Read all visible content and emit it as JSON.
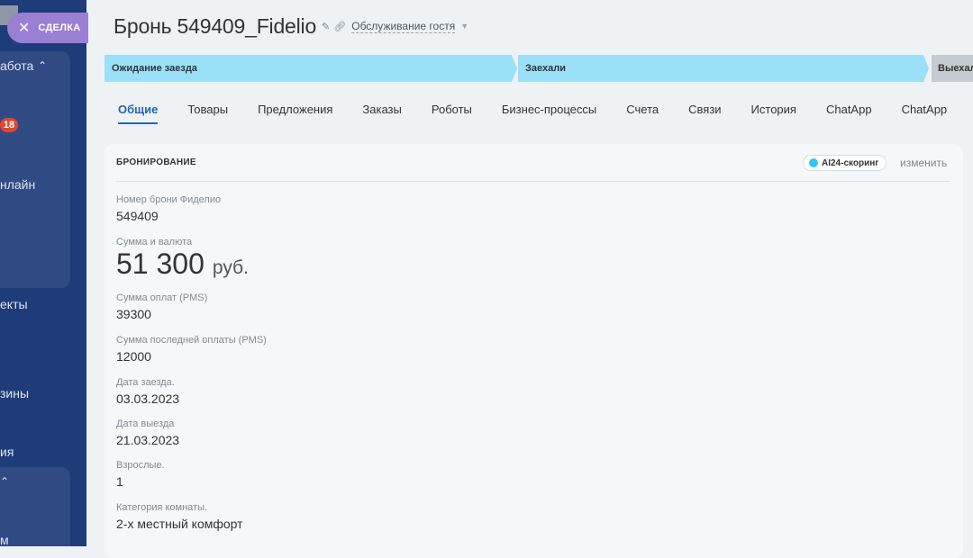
{
  "sidebar": {
    "close_label": "СДЕЛКА",
    "items": [
      {
        "label": "абота"
      },
      {
        "label": "нлайн"
      },
      {
        "label": "екты"
      },
      {
        "label": "зины"
      },
      {
        "label": "ия"
      },
      {
        "label": "м"
      }
    ],
    "badge_count": "18"
  },
  "header": {
    "title": "Бронь 549409_Fidelio",
    "category": "Обслуживание гостя"
  },
  "stages": [
    {
      "label": "Ожидание заезда",
      "color": "#9be0f9"
    },
    {
      "label": "Заехали",
      "color": "#9be0f9"
    },
    {
      "label": "Выехали",
      "color": "#c5cbd1"
    }
  ],
  "tabs": [
    {
      "label": "Общие",
      "active": true
    },
    {
      "label": "Товары"
    },
    {
      "label": "Предложения"
    },
    {
      "label": "Заказы"
    },
    {
      "label": "Роботы"
    },
    {
      "label": "Бизнес-процессы"
    },
    {
      "label": "Счета"
    },
    {
      "label": "Связи"
    },
    {
      "label": "История"
    },
    {
      "label": "ChatApp"
    },
    {
      "label": "ChatApp"
    }
  ],
  "card": {
    "title": "БРОНИРОВАНИЕ",
    "ai_label": "AI24-скоринг",
    "change_label": "изменить",
    "fields": {
      "booking_number": {
        "label": "Номер брони Фиделио",
        "value": "549409"
      },
      "amount": {
        "label": "Сумма и валюта",
        "value": "51 300",
        "currency": "руб."
      },
      "paid": {
        "label": "Сумма оплат (PMS)",
        "value": "39300"
      },
      "last_payment": {
        "label": "Сумма последней оплаты (PMS)",
        "value": "12000"
      },
      "checkin": {
        "label": "Дата заезда.",
        "value": "03.03.2023"
      },
      "checkout": {
        "label": "Дата выезда",
        "value": "21.03.2023"
      },
      "adults": {
        "label": "Взрослые.",
        "value": "1"
      },
      "room": {
        "label": "Категория комнаты.",
        "value": "2-х местный комфорт"
      }
    }
  },
  "colors": {
    "sidebar_bg": "#1f3c7a",
    "accent": "#2066b0",
    "stage_active": "#9be0f9",
    "stage_inactive": "#c5cbd1"
  }
}
